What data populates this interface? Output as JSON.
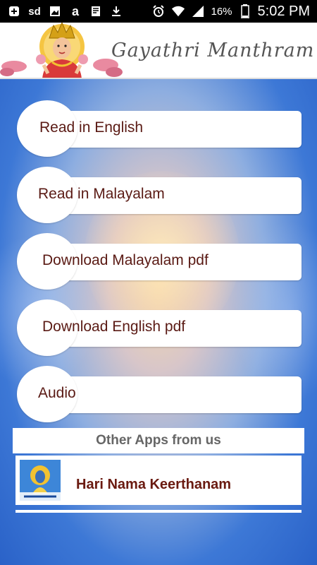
{
  "status_bar": {
    "icons": [
      "notification-icon",
      "sd-card-icon",
      "image-icon",
      "amazon-icon",
      "news-icon",
      "download-icon",
      "alarm-icon",
      "wifi-icon",
      "signal-icon",
      "battery-icon"
    ],
    "sd_label": "sd",
    "battery": "16%",
    "time": "5:02 PM"
  },
  "header": {
    "title": "Gayathri Manthram"
  },
  "menu": [
    {
      "label": "Read in English"
    },
    {
      "label": "Read in Malayalam"
    },
    {
      "label": "Download Malayalam pdf"
    },
    {
      "label": "Download English pdf"
    },
    {
      "label": "Audio"
    }
  ],
  "other_apps": {
    "heading": "Other Apps from us",
    "apps": [
      {
        "name": "Hari Nama Keerthanam"
      }
    ]
  },
  "colors": {
    "label_text": "#5a1a14",
    "app_name": "#6a1a10",
    "background_blue": "#2a62c8"
  }
}
